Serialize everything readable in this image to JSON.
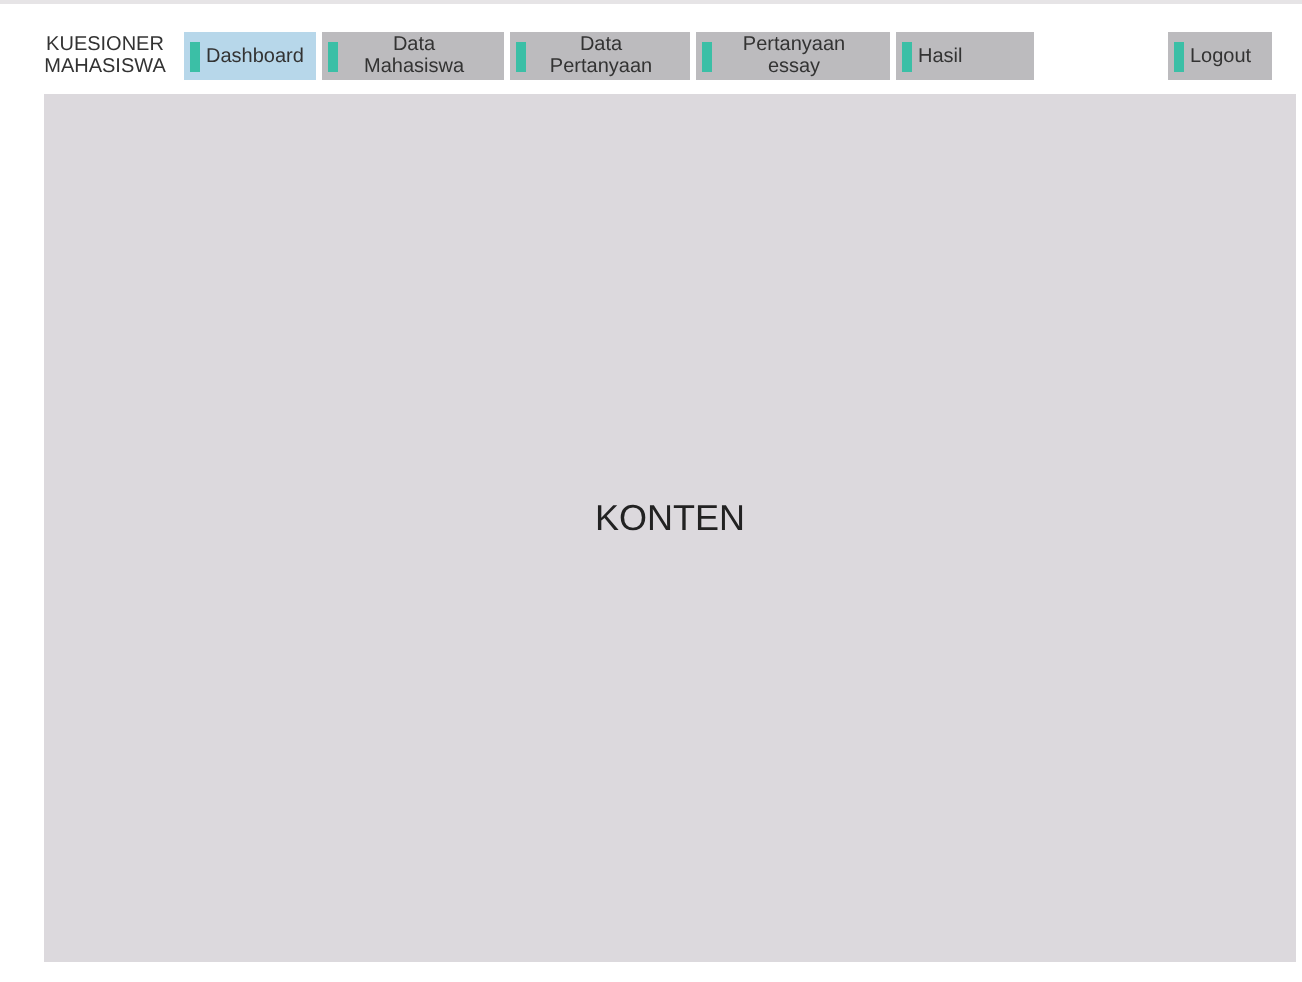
{
  "brand": "KUESIONER MAHASISWA",
  "nav": [
    {
      "label": "Dashboard",
      "selected": true
    },
    {
      "label": "Data Mahasiswa",
      "selected": false
    },
    {
      "label": "Data Pertanyaan",
      "selected": false
    },
    {
      "label": "Pertanyaan essay",
      "selected": false
    },
    {
      "label": "Hasil",
      "selected": false
    }
  ],
  "logout": "Logout",
  "content": "KONTEN"
}
